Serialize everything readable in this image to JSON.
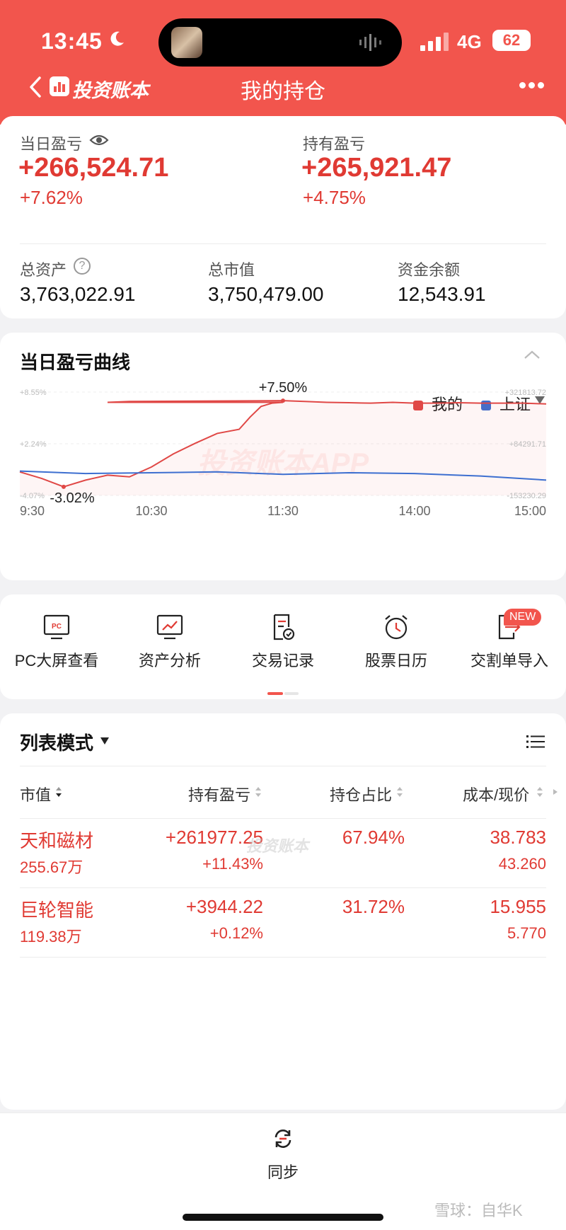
{
  "status_bar": {
    "time": "13:45",
    "network": "4G",
    "battery": "62"
  },
  "nav": {
    "brand": "投资账本",
    "title": "我的持仓"
  },
  "summary": {
    "daily_pnl_label": "当日盈亏",
    "daily_pnl_value": "+266,524.71",
    "daily_pnl_pct": "+7.62%",
    "holding_pnl_label": "持有盈亏",
    "holding_pnl_value": "+265,921.47",
    "holding_pnl_pct": "+4.75%",
    "total_assets_label": "总资产",
    "total_assets_value": "3,763,022.91",
    "market_value_label": "总市值",
    "market_value_value": "3,750,479.00",
    "cash_label": "资金余额",
    "cash_value": "12,543.91"
  },
  "chart_section": {
    "title": "当日盈亏曲线",
    "watermark": "投资账本APP",
    "peak_annotation": "+7.50%",
    "trough_annotation": "-3.02%"
  },
  "chart_data": {
    "type": "line",
    "x_ticks": [
      "9:30",
      "10:30",
      "11:30",
      "14:00",
      "15:00"
    ],
    "y_left_ticks": [
      "+8.55%",
      "+2.24%",
      "-4.07%"
    ],
    "y_right_ticks": [
      "+321813.72",
      "+84291.71",
      "-153230.29"
    ],
    "ylim": [
      -4.07,
      8.55
    ],
    "legend_position": "top-right",
    "series": [
      {
        "name": "我的",
        "color": "#e04846",
        "x": [
          "9:30",
          "9:40",
          "9:50",
          "10:00",
          "10:10",
          "10:20",
          "10:30",
          "10:40",
          "10:50",
          "11:00",
          "11:10",
          "11:15",
          "11:20",
          "11:25",
          "11:30",
          "11:40",
          "11:50",
          "13:00",
          "13:10",
          "13:20",
          "13:30",
          "13:40",
          "13:50",
          "14:00",
          "14:10",
          "14:20",
          "14:30",
          "14:40",
          "14:50",
          "15:00"
        ],
        "values": [
          -1.2,
          -2.0,
          -3.02,
          -2.2,
          -1.6,
          -1.8,
          -0.6,
          1.0,
          2.3,
          3.5,
          4.0,
          5.5,
          6.8,
          7.2,
          7.3,
          7.3,
          7.4,
          7.5,
          7.4,
          7.3,
          7.25,
          7.2,
          7.3,
          7.2,
          7.2,
          7.25,
          7.2,
          7.2,
          7.2,
          7.1
        ]
      },
      {
        "name": "上证",
        "color": "#3d6fd0",
        "x": [
          "9:30",
          "10:00",
          "10:30",
          "11:00",
          "11:30",
          "13:30",
          "14:00",
          "14:30",
          "15:00"
        ],
        "values": [
          -1.1,
          -1.4,
          -1.3,
          -1.2,
          -1.5,
          -1.3,
          -1.4,
          -1.7,
          -2.2
        ]
      }
    ]
  },
  "tools": [
    {
      "label": "PC大屏查看",
      "icon": "pc-screen-icon"
    },
    {
      "label": "资产分析",
      "icon": "analysis-chart-icon"
    },
    {
      "label": "交易记录",
      "icon": "trade-record-icon"
    },
    {
      "label": "股票日历",
      "icon": "alarm-clock-icon"
    },
    {
      "label": "交割单导入",
      "icon": "import-icon",
      "badge": "NEW"
    }
  ],
  "list": {
    "mode": "列表模式",
    "headers": [
      "市值",
      "持有盈亏",
      "持仓占比",
      "成本/现价"
    ],
    "watermark": "投资账本",
    "rows": [
      {
        "name": "天和磁材",
        "market_value": "255.67万",
        "pnl": "+261977.25",
        "pnl_pct": "+11.43%",
        "ratio": "67.94%",
        "cost": "38.783",
        "price": "43.260"
      },
      {
        "name": "巨轮智能",
        "market_value": "119.38万",
        "pnl": "+3944.22",
        "pnl_pct": "+0.12%",
        "ratio": "31.72%",
        "cost": "15.955",
        "price": "5.770"
      }
    ]
  },
  "bottom": {
    "sync_label": "同步",
    "credit": "雪球：自华K"
  },
  "colors": {
    "header": "#f2554d",
    "up": "#e03a33",
    "index": "#3d6fd0"
  }
}
